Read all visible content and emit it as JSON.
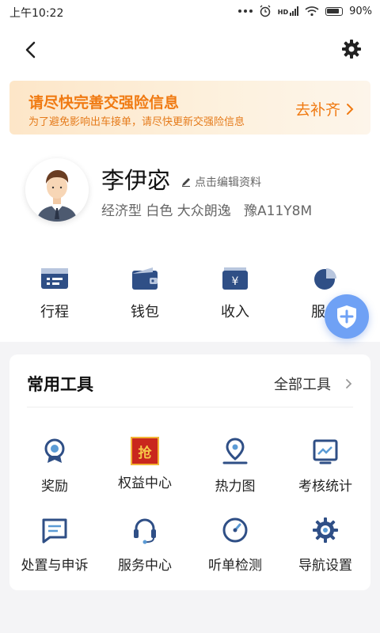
{
  "status_bar": {
    "time": "上午10:22",
    "battery": "90%",
    "signal_label": "HD"
  },
  "banner": {
    "title": "请尽快完善交强险信息",
    "subtitle": "为了避免影响出车接单，请尽快更新交强险信息",
    "action": "去补齐"
  },
  "profile": {
    "name": "李伊宓",
    "edit_label": "点击编辑资料",
    "car_info": "经济型 白色 大众朗逸   豫A11Y8M"
  },
  "quick_actions": [
    {
      "label": "行程",
      "icon": "itinerary-icon"
    },
    {
      "label": "钱包",
      "icon": "wallet-icon"
    },
    {
      "label": "收入",
      "icon": "income-icon"
    },
    {
      "label": "服务",
      "icon": "service-chart-icon"
    }
  ],
  "tools": {
    "title": "常用工具",
    "all_label": "全部工具",
    "items": [
      {
        "label": "奖励",
        "icon": "award-icon"
      },
      {
        "label": "权益中心",
        "icon": "rights-badge-icon",
        "badge": "抢"
      },
      {
        "label": "热力图",
        "icon": "heatmap-pin-icon"
      },
      {
        "label": "考核统计",
        "icon": "stats-board-icon"
      },
      {
        "label": "处置与申诉",
        "icon": "appeal-message-icon"
      },
      {
        "label": "服务中心",
        "icon": "headset-icon"
      },
      {
        "label": "听单检测",
        "icon": "gauge-icon"
      },
      {
        "label": "导航设置",
        "icon": "nav-gear-icon"
      }
    ]
  },
  "colors": {
    "accent_orange": "#f07a12",
    "accent_blue": "#2f6fcf",
    "fab_blue": "#6fa1f5"
  }
}
